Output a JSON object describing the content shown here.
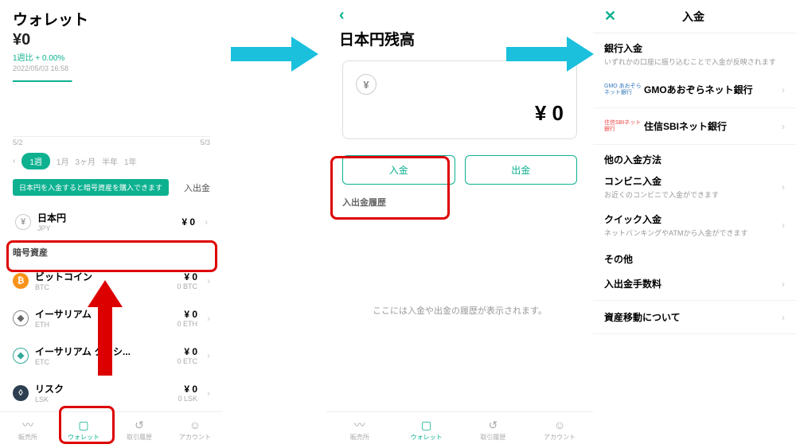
{
  "s1": {
    "title": "ウォレット",
    "amount": "¥0",
    "delta": "1週比 + 0.00%",
    "timestamp": "2022/05/03 16:58",
    "xleft": "5/2",
    "xright": "5/3",
    "ranges": [
      "1週",
      "1月",
      "3ヶ月",
      "半年",
      "1年"
    ],
    "promo": "日本円を入金すると暗号資産を購入できます",
    "io": "入出金",
    "cryptoLabel": "暗号資産",
    "assets": [
      {
        "name": "日本円",
        "ticker": "JPY",
        "value": "¥ 0",
        "sub": ""
      },
      {
        "name": "ビットコイン",
        "ticker": "BTC",
        "value": "¥ 0",
        "sub": "0 BTC"
      },
      {
        "name": "イーサリアム",
        "ticker": "ETH",
        "value": "¥ 0",
        "sub": "0 ETH"
      },
      {
        "name": "イーサリアム クラシ...",
        "ticker": "ETC",
        "value": "¥ 0",
        "sub": "0 ETC"
      },
      {
        "name": "リスク",
        "ticker": "LSK",
        "value": "¥ 0",
        "sub": "0 LSK"
      }
    ],
    "tabs": [
      "販売所",
      "ウォレット",
      "取引履歴",
      "アカウント"
    ]
  },
  "s2": {
    "title": "日本円残高",
    "balance": "¥ 0",
    "deposit": "入金",
    "withdraw": "出金",
    "history": "入出金履歴",
    "empty": "ここには入金や出金の履歴が表示されます。",
    "tabs": [
      "販売所",
      "ウォレット",
      "取引履歴",
      "アカウント"
    ]
  },
  "s3": {
    "title": "入金",
    "bankTitle": "銀行入金",
    "bankDesc": "いずれかの口座に振り込むことで入金が反映されます",
    "gmoIcon": "GMO\nあおぞらネット銀行",
    "gmoName": "GMOあおぞらネット銀行",
    "sbiIcon": "住信SBIネット銀行",
    "sbiName": "住信SBIネット銀行",
    "otherMethods": "他の入金方法",
    "konbini": "コンビニ入金",
    "konbiniDesc": "お近くのコンビニで入金ができます",
    "quick": "クイック入金",
    "quickDesc": "ネットバンキングやATMから入金ができます",
    "other": "その他",
    "fees": "入出金手数料",
    "transfer": "資産移動について"
  }
}
